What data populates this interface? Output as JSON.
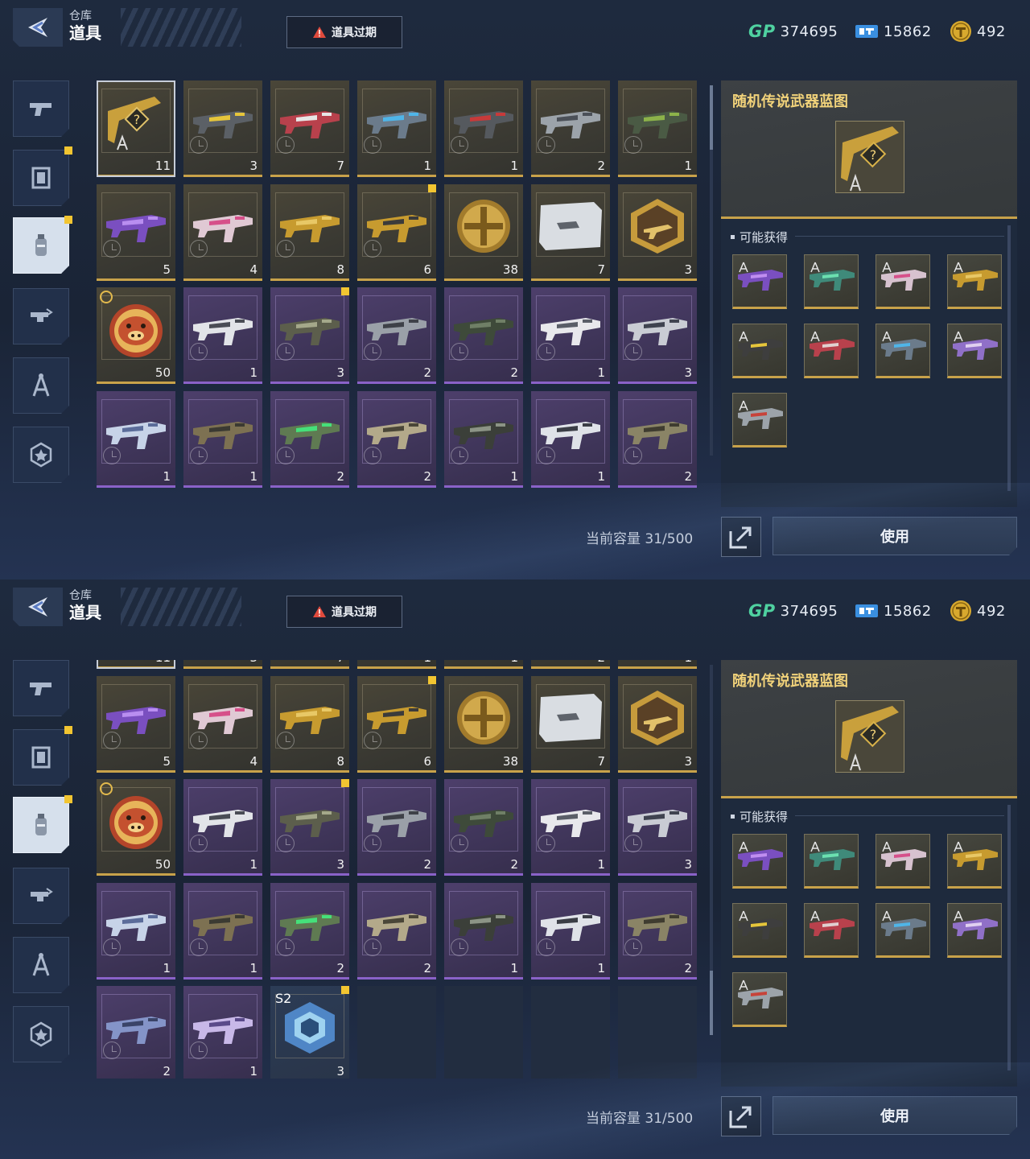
{
  "header": {
    "breadcrumb": "仓库",
    "title": "道具",
    "expire_button": "道具过期"
  },
  "currencies": {
    "gp": "374695",
    "ticket": "15862",
    "coin": "492"
  },
  "sidebar": {
    "items": [
      {
        "icon": "pistol-icon",
        "badge": false,
        "active": false
      },
      {
        "icon": "frame-icon",
        "badge": true,
        "active": false
      },
      {
        "icon": "grenade-icon",
        "badge": true,
        "active": true
      },
      {
        "icon": "weapon-parts-icon",
        "badge": false,
        "active": false
      },
      {
        "icon": "blueprint-icon",
        "badge": false,
        "active": false
      },
      {
        "icon": "star-badge-icon",
        "badge": false,
        "active": false
      }
    ]
  },
  "inventory": {
    "capacity_text": "当前容量 31/500",
    "items": [
      {
        "qty": "11",
        "rarity": "gold",
        "icon": "gold-blueprint-icon",
        "selected": true
      },
      {
        "qty": "3",
        "rarity": "gold",
        "icon": "yellow-rifle-icon"
      },
      {
        "qty": "7",
        "rarity": "gold",
        "icon": "red-rifle-icon"
      },
      {
        "qty": "1",
        "rarity": "gold",
        "icon": "blue-rifle-icon"
      },
      {
        "qty": "1",
        "rarity": "gold",
        "icon": "grey-rifle-icon"
      },
      {
        "qty": "2",
        "rarity": "gold",
        "icon": "silver-rifle-icon"
      },
      {
        "qty": "1",
        "rarity": "gold",
        "icon": "green-rifle-icon"
      },
      {
        "qty": "5",
        "rarity": "gold",
        "icon": "purple-rifle-icon"
      },
      {
        "qty": "4",
        "rarity": "gold",
        "icon": "pink-rifle-icon"
      },
      {
        "qty": "8",
        "rarity": "gold",
        "icon": "gold-rifle-icon"
      },
      {
        "qty": "6",
        "rarity": "gold",
        "icon": "gold-parts-icon",
        "badge": true
      },
      {
        "qty": "38",
        "rarity": "gold",
        "icon": "gold-medal-icon"
      },
      {
        "qty": "7",
        "rarity": "gold",
        "icon": "silver-case-icon"
      },
      {
        "qty": "3",
        "rarity": "gold",
        "icon": "gold-hex-badge-icon"
      },
      {
        "qty": "50",
        "rarity": "gold",
        "icon": "pig-coin-icon",
        "timed": true
      },
      {
        "qty": "1",
        "rarity": "purple",
        "icon": "white-smg-icon"
      },
      {
        "qty": "3",
        "rarity": "purple",
        "icon": "launcher-icon",
        "badge": true
      },
      {
        "qty": "2",
        "rarity": "purple",
        "icon": "grey-smg-icon"
      },
      {
        "qty": "2",
        "rarity": "purple",
        "icon": "rocket-icon"
      },
      {
        "qty": "1",
        "rarity": "purple",
        "icon": "white-pistol-icon"
      },
      {
        "qty": "3",
        "rarity": "purple",
        "icon": "bow-icon"
      },
      {
        "qty": "1",
        "rarity": "purple",
        "icon": "wire-bow-icon"
      },
      {
        "qty": "1",
        "rarity": "purple",
        "icon": "tan-sniper-icon"
      },
      {
        "qty": "2",
        "rarity": "purple",
        "icon": "green-smg-icon"
      },
      {
        "qty": "2",
        "rarity": "purple",
        "icon": "tan-smg-icon"
      },
      {
        "qty": "1",
        "rarity": "purple",
        "icon": "drum-rifle-icon"
      },
      {
        "qty": "1",
        "rarity": "purple",
        "icon": "white-rifle-icon"
      },
      {
        "qty": "2",
        "rarity": "purple",
        "icon": "olive-smg-icon"
      },
      {
        "qty": "2",
        "rarity": "purple",
        "icon": "blue-crossbow-icon"
      },
      {
        "qty": "1",
        "rarity": "purple",
        "icon": "blade-icon"
      },
      {
        "qty": "3",
        "rarity": "blue",
        "icon": "crate-icon",
        "season": "S2",
        "badge": true
      }
    ]
  },
  "detail": {
    "title": "随机传说武器蓝图",
    "may_obtain_label": "可能获得",
    "rewards": [
      "purple",
      "teal",
      "pink",
      "gold",
      "yellow",
      "red",
      "blue",
      "violet",
      "silver"
    ]
  },
  "actions": {
    "use_label": "使用"
  },
  "colors": {
    "gold_rarity": "#c8a24a",
    "purple_rarity": "#8a62c8",
    "blue_rarity": "#4f86c6",
    "gp_green": "#4fd1a0",
    "warn_red": "#e04a3c",
    "badge_yellow": "#f2c531"
  }
}
